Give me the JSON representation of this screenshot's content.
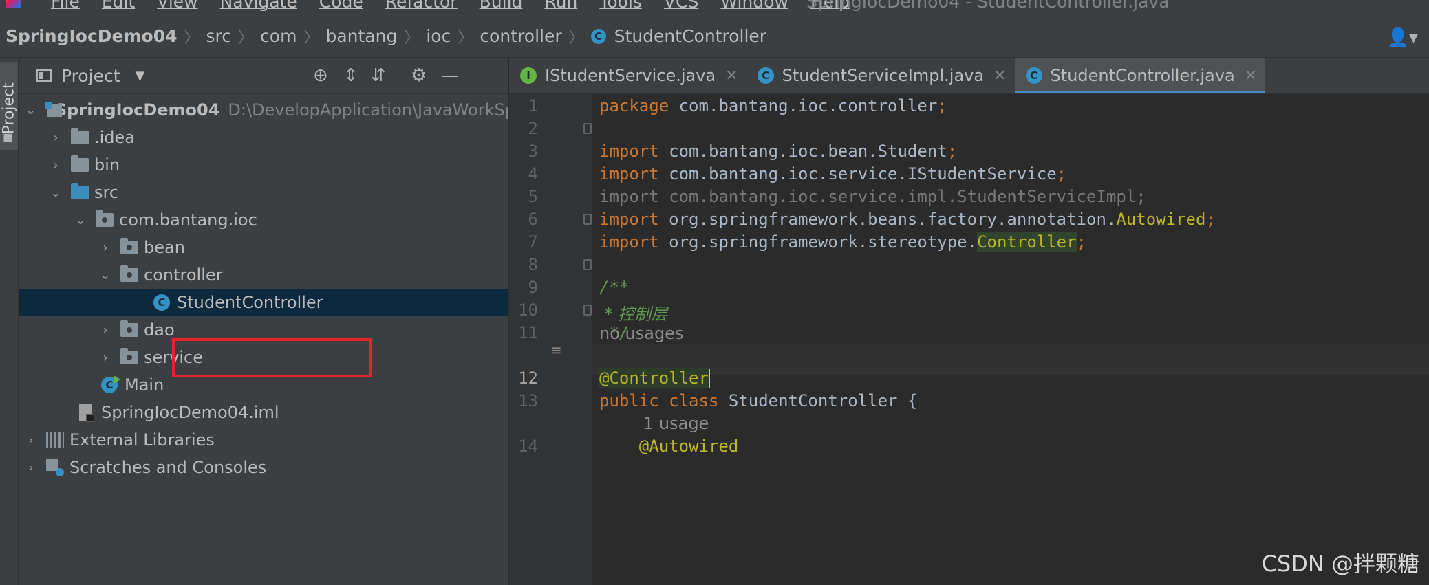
{
  "menubar": {
    "items": [
      "File",
      "Edit",
      "View",
      "Navigate",
      "Code",
      "Refactor",
      "Build",
      "Run",
      "Tools",
      "VCS",
      "Window",
      "Help"
    ],
    "window_title": "SpringIocDemo04 - StudentController.java"
  },
  "breadcrumb": {
    "items": [
      "SpringIocDemo04",
      "src",
      "com",
      "bantang",
      "ioc",
      "controller",
      "StudentController"
    ],
    "class_badge": "C"
  },
  "tool_strip": {
    "label": "Project"
  },
  "project_panel": {
    "title": "Project",
    "tree": [
      {
        "label": "SpringIocDemo04",
        "hint": "D:\\DevelopApplication\\JavaWorkSp"
      },
      {
        "label": ".idea"
      },
      {
        "label": "bin"
      },
      {
        "label": "src"
      },
      {
        "label": "com.bantang.ioc"
      },
      {
        "label": "bean"
      },
      {
        "label": "controller"
      },
      {
        "label": "StudentController"
      },
      {
        "label": "dao"
      },
      {
        "label": "service"
      },
      {
        "label": "Main"
      },
      {
        "label": "SpringIocDemo04.iml"
      },
      {
        "label": "External Libraries"
      },
      {
        "label": "Scratches and Consoles"
      }
    ],
    "selected_item": "StudentController"
  },
  "editor_tabs": [
    {
      "label": "IStudentService.java",
      "icon": "I",
      "active": false
    },
    {
      "label": "StudentServiceImpl.java",
      "icon": "C",
      "active": false
    },
    {
      "label": "StudentController.java",
      "icon": "C",
      "active": true
    }
  ],
  "editor": {
    "line_numbers": [
      "1",
      "2",
      "3",
      "4",
      "5",
      "6",
      "7",
      "8",
      "9",
      "10",
      "11",
      "12",
      "13",
      "14"
    ],
    "code": {
      "l1_kw": "package",
      "l1_rest": " com.bantang.ioc.controller",
      "l1_semi": ";",
      "l3_kw": "import",
      "l3_rest": " com.bantang.ioc.bean.Student",
      "l3_semi": ";",
      "l4_kw": "import",
      "l4_rest": " com.bantang.ioc.service.IStudentService",
      "l4_semi": ";",
      "l5_text": "import com.bantang.ioc.service.impl.StudentServiceImpl;",
      "l6_kw": "import",
      "l6_rest": " org.springframework.beans.factory.annotation.",
      "l6_ann": "Autowired",
      "l6_semi": ";",
      "l7_kw": "import",
      "l7_rest": " org.springframework.stereotype.",
      "l7_ann": "Controller",
      "l7_semi": ";",
      "l9": "/**",
      "l10": " * 控制层",
      "l11": " */",
      "l12": "@Controller",
      "l13_kw": "public class",
      "l13_rest": " StudentController {",
      "l14": "    @Autowired"
    },
    "hints": {
      "no_usages": "no usages",
      "one_usage": "1 usage"
    }
  },
  "watermark": "CSDN @拌颗糖"
}
